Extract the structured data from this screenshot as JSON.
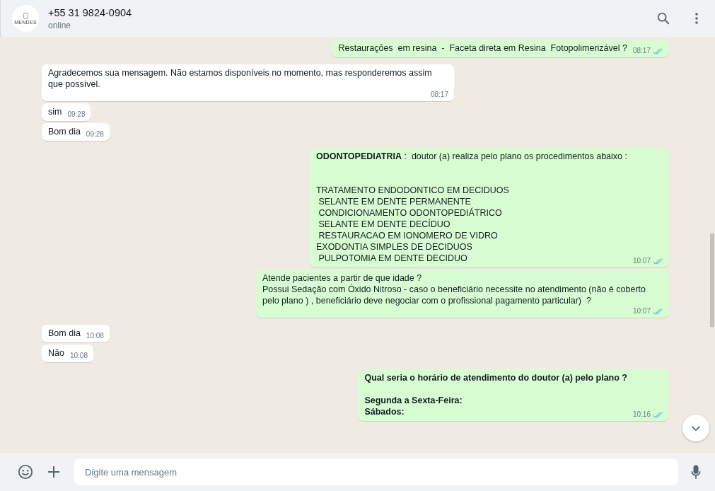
{
  "header": {
    "avatar_text": "MENDES",
    "name": "+55 31 9824-0904",
    "status": "online"
  },
  "messages": [
    {
      "kind": "out",
      "text": "Restaurações  em resina  -  Faceta direta em Resina  Fotopolimerizável ?",
      "bold": false,
      "time": "08:17",
      "read": true
    },
    {
      "kind": "in",
      "text": "Agradecemos sua mensagem. Não estamos disponíveis no momento, mas responderemos assim que possível.",
      "bold": false,
      "time": "08:17"
    },
    {
      "kind": "in",
      "text": "sim",
      "bold": false,
      "time": "09:28"
    },
    {
      "kind": "in",
      "text": "Bom dia",
      "bold": false,
      "time": "09:28"
    },
    {
      "kind": "out",
      "text": "**ODONTOPEDIATRIA** :  doutor (a) realiza pelo plano os procedimentos abaixo :\n\n\nTRATAMENTO ENDODONTICO EM DECIDUOS\n SELANTE EM DENTE PERMANENTE\n CONDICIONAMENTO ODONTOPEDIÁTRICO\n SELANTE EM DENTE DECÍDUO\n RESTAURACAO EM IONOMERO DE VIDRO\nEXODONTIA SIMPLES DE DECIDUOS\n PULPOTOMIA EM DENTE DECIDUO",
      "bold": false,
      "time": "10:07",
      "read": true
    },
    {
      "kind": "out",
      "text": "Atende pacientes a partir de que idade ?\nPossui Sedação com Óxido Nitroso - caso o beneficiário necessite no atendimento (não é coberto pelo plano ) , beneficiário deve negociar com o profissional pagamento particular)  ?",
      "bold": false,
      "time": "10:07",
      "read": true
    },
    {
      "kind": "in",
      "text": "Bom dia",
      "bold": false,
      "time": "10:08"
    },
    {
      "kind": "in",
      "text": "Não",
      "bold": false,
      "time": "10:08"
    },
    {
      "kind": "out",
      "text": "Qual seria o horário de atendimento do doutor (a) pelo plano ?\n\nSegunda a Sexta-Feira:\nSábados:",
      "bold": true,
      "time": "10:16",
      "read": true
    }
  ],
  "composer": {
    "placeholder": "Digite uma mensagem"
  }
}
